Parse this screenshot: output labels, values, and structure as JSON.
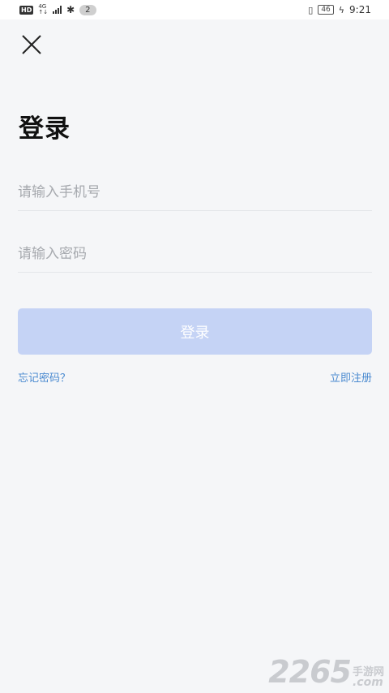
{
  "status_bar": {
    "hd": "HD",
    "network_top": "4G",
    "network_bottom": "↑↓",
    "notification_count": "2",
    "battery": "46",
    "time": "9:21"
  },
  "header": {
    "title": "登录"
  },
  "form": {
    "phone_placeholder": "请输入手机号",
    "phone_value": "",
    "password_placeholder": "请输入密码",
    "password_value": "",
    "login_label": "登录",
    "forgot_label": "忘记密码？",
    "register_label": "立即注册"
  },
  "watermark": {
    "number": "2265",
    "cn": "手游网",
    "suffix": ".com"
  },
  "colors": {
    "background": "#f5f6f8",
    "button_disabled": "#c5d3f5",
    "link": "#4a8ad0"
  }
}
